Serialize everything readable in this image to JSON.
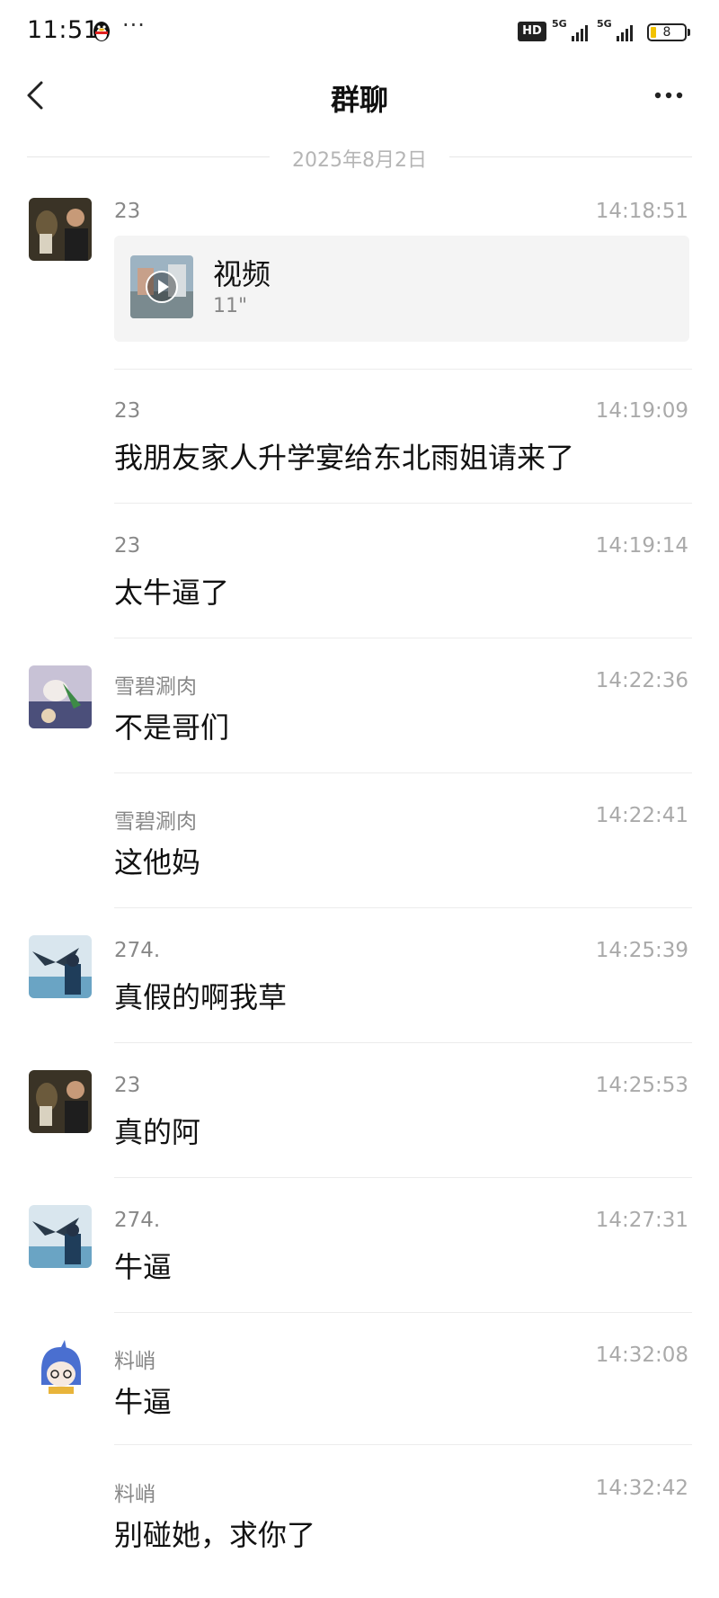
{
  "status_bar": {
    "time": "11:51",
    "dots": "···",
    "hd": "HD",
    "network": "5G",
    "battery": "8"
  },
  "nav": {
    "title": "群聊",
    "back_icon": "chevron-left-icon",
    "more_icon": "more-dots-icon"
  },
  "date_divider": "2025年8月2日",
  "colors": {
    "name_gray": "#888888",
    "time_gray": "#aaaaaa",
    "divider": "#ececec",
    "card_bg": "#f4f4f4"
  },
  "messages": [
    {
      "sender": "23",
      "time": "14:18:51",
      "type": "video",
      "video_label": "视频",
      "video_duration": "11\""
    },
    {
      "sender": "23",
      "time": "14:19:09",
      "text": "我朋友家人升学宴给东北雨姐请来了"
    },
    {
      "sender": "23",
      "time": "14:19:14",
      "text": "太牛逼了"
    },
    {
      "sender": "雪碧涮肉",
      "time": "14:22:36",
      "text": "不是哥们"
    },
    {
      "sender": "雪碧涮肉",
      "time": "14:22:41",
      "text": "这他妈"
    },
    {
      "sender": "274.",
      "time": "14:25:39",
      "text": "真假的啊我草"
    },
    {
      "sender": "23",
      "time": "14:25:53",
      "text": "真的阿"
    },
    {
      "sender": "274.",
      "time": "14:27:31",
      "text": "牛逼"
    },
    {
      "sender": "料峭",
      "time": "14:32:08",
      "text": "牛逼"
    },
    {
      "sender": "料峭",
      "time": "14:32:42",
      "text": "别碰她，求你了"
    }
  ]
}
